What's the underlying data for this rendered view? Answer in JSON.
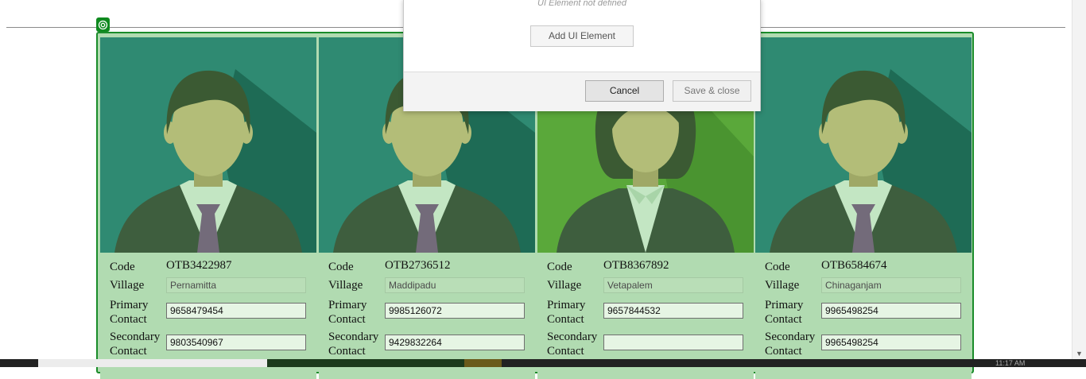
{
  "dialog": {
    "not_defined_text": "UI Element not defined",
    "add_button": "Add UI Element",
    "cancel_button": "Cancel",
    "save_button": "Save & close"
  },
  "labels": {
    "code": "Code",
    "village": "Village",
    "primary_line1": "Primary",
    "primary_line2": "Contact",
    "secondary_line1": "Secondary",
    "secondary_line2": "Contact"
  },
  "cards": [
    {
      "code": "OTB3422987",
      "village": "Pernamitta",
      "primary_contact": "9658479454",
      "secondary_contact": "9803540967",
      "avatar": "male-avatar-icon"
    },
    {
      "code": "OTB2736512",
      "village": "Maddipadu",
      "primary_contact": "9985126072",
      "secondary_contact": "9429832264",
      "avatar": "male-avatar-icon"
    },
    {
      "code": "OTB8367892",
      "village": "Vetapalem",
      "primary_contact": "9657844532",
      "secondary_contact": "",
      "avatar": "female-avatar-icon"
    },
    {
      "code": "OTB6584674",
      "village": "Chinaganjam",
      "primary_contact": "9965498254",
      "secondary_contact": "9965498254",
      "avatar": "male-avatar-icon"
    }
  ],
  "colors": {
    "male_bg": "#2f8a72",
    "female_bg": "#5aa83a",
    "card_bg": "#b1dbb1",
    "border": "#1a8c2a"
  },
  "taskbar": {
    "clock": "11:17 AM"
  }
}
